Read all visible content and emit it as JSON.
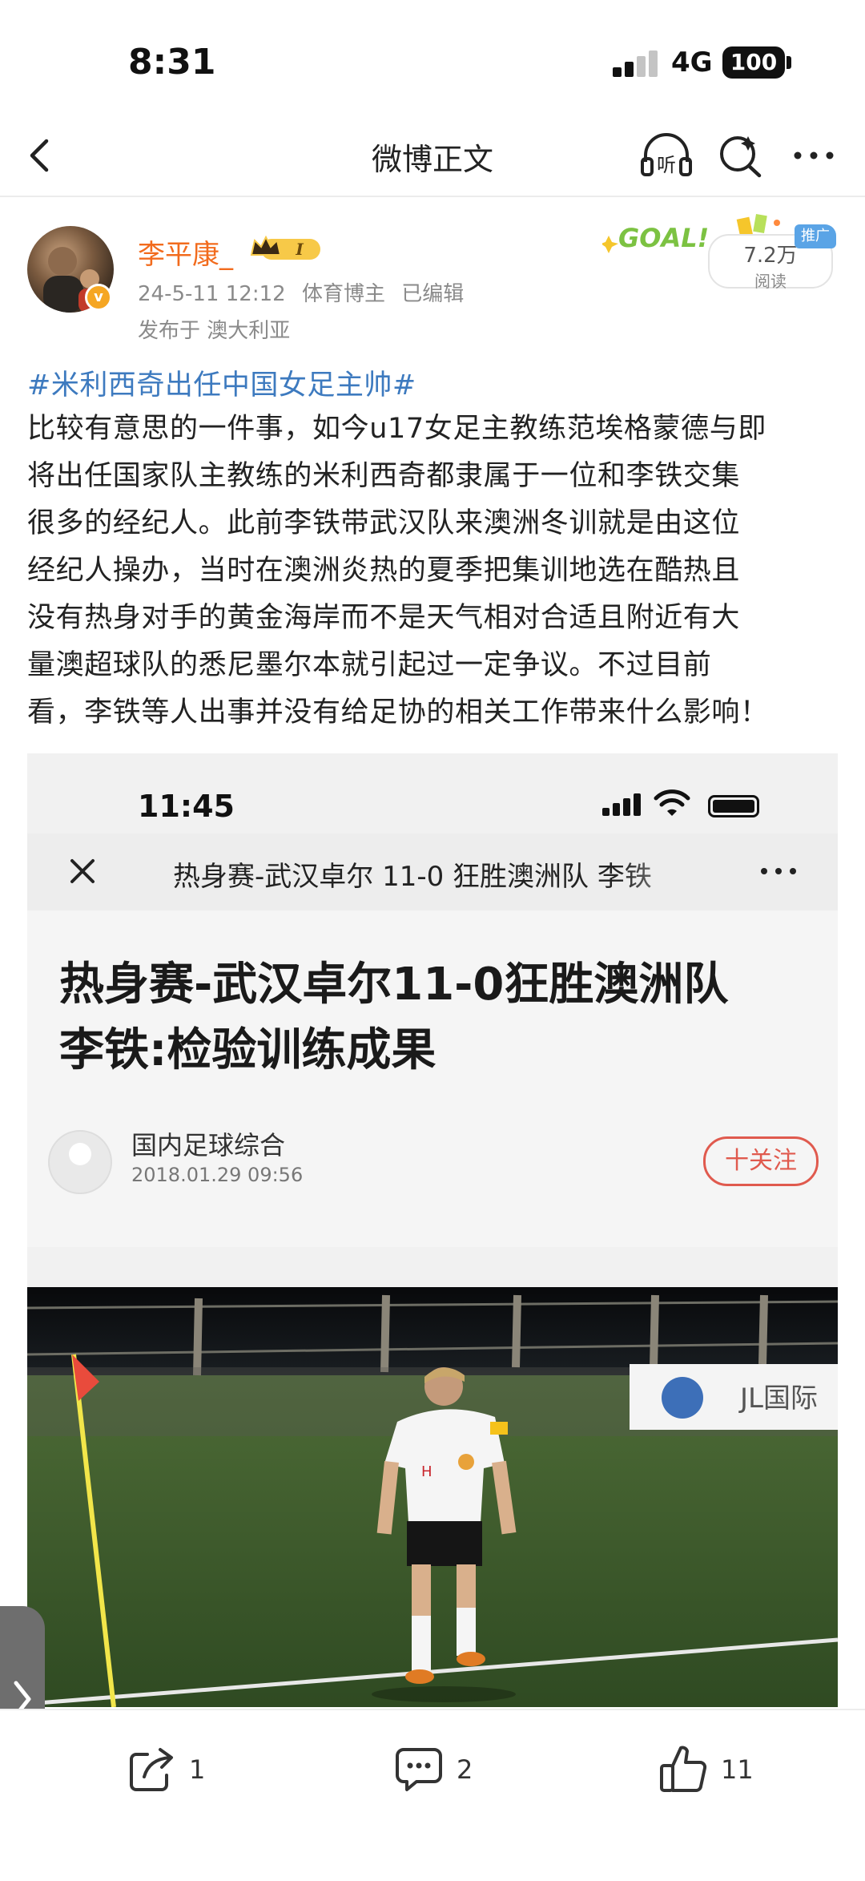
{
  "status_bar": {
    "time": "8:31",
    "network": "4G",
    "battery": "100"
  },
  "nav": {
    "title": "微博正文",
    "icons": [
      "back-icon",
      "listen-icon",
      "voice-search-icon",
      "more-icon"
    ]
  },
  "author": {
    "name": "李平康_",
    "badge_icon": "crown-level-icon",
    "badge_text": "I",
    "date": "24-5-11 12:12",
    "role": "体育博主",
    "edited": "已编辑",
    "location": "发布于 澳大利亚",
    "read_count": "7.2万",
    "read_label": "阅读",
    "promo_tag": "推广",
    "decor_text": "GOAL!"
  },
  "post": {
    "hashtag": "#米利西奇出任中国女足主帅#",
    "lines": [
      "比较有意思的一件事，如今u17女足主教练范埃格蒙德与即",
      "将出任国家队主教练的米利西奇都隶属于一位和李铁交集",
      "很多的经纪人。此前李铁带武汉队来澳洲冬训就是由这位",
      "经纪人操办，当时在澳洲炎热的夏季把集训地选在酷热且",
      "没有热身对手的黄金海岸而不是天气相对合适且附近有大",
      "量澳超球队的悉尼墨尔本就引起过一定争议。不过目前",
      "看，李铁等人出事并没有给足协的相关工作带来什么影响！"
    ]
  },
  "embed": {
    "time": "11:45",
    "nav_title": "热身赛-武汉卓尔 11-0 狂胜澳洲队 李铁",
    "headline_line1": "热身赛-武汉卓尔11-0狂胜澳洲队",
    "headline_line2": "李铁:检验训练成果",
    "source": "国内足球综合",
    "date": "2018.01.29 09:56",
    "follow": "十关注",
    "banner_text": "JL国际"
  },
  "actions": {
    "share": {
      "icon": "share-icon",
      "count": "1"
    },
    "comment": {
      "icon": "comment-icon",
      "count": "2"
    },
    "like": {
      "icon": "like-icon",
      "count": "11"
    }
  },
  "colors": {
    "author_name": "#f26b1d",
    "hashtag": "#3d7abf",
    "follow": "#e05a4e",
    "goal": "#7cc242"
  }
}
